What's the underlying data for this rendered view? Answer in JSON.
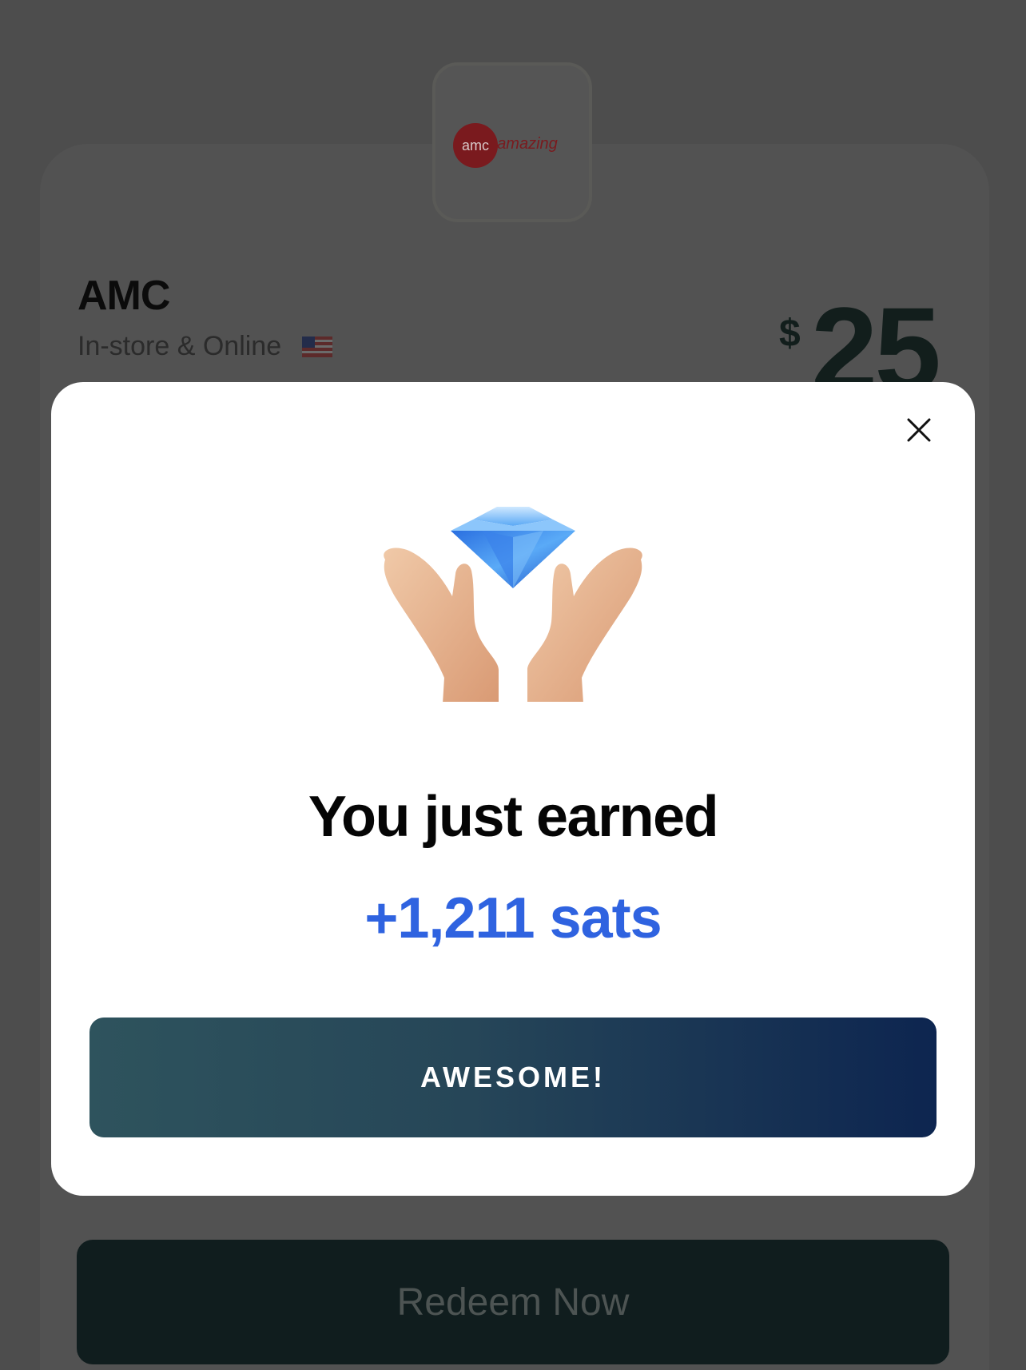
{
  "background": {
    "merchant": {
      "logo_text_left": "amc",
      "logo_text_right": "amazing",
      "name": "AMC",
      "availability": "In-store & Online",
      "country_flag_icon": "us-flag-icon"
    },
    "price": {
      "currency": "$",
      "amount": "25"
    },
    "redeem_label": "Redeem Now"
  },
  "modal": {
    "close_icon": "close-icon",
    "illustration_icon": "diamond-hands-icon",
    "title": "You just earned",
    "reward": "+1,211 sats",
    "primary_label": "AWESOME!"
  },
  "colors": {
    "reward_blue": "#2f63e0",
    "button_gradient_start": "#2e535d",
    "button_gradient_end": "#0d2550",
    "overlay": "#4d4d4d"
  }
}
